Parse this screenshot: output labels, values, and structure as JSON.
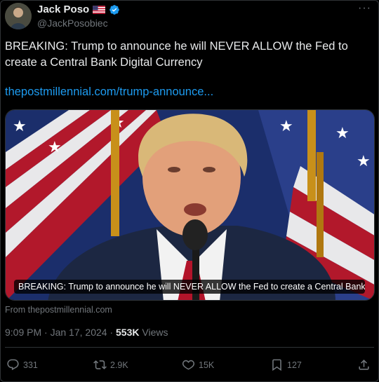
{
  "author": {
    "display_name": "Jack Poso",
    "handle": "@JackPosobiec",
    "flag_icon": "us-flag-icon",
    "verified_icon": "verified-badge-icon",
    "verified_color": "#1d9bf0"
  },
  "menu": {
    "more_label": "···"
  },
  "tweet": {
    "text": "BREAKING: Trump to announce he will NEVER ALLOW the Fed to create a Central Bank Digital Currency",
    "link": "thepostmillennial.com/trump-announce...",
    "link_color": "#1d9bf0"
  },
  "media": {
    "caption": "BREAKING: Trump to announce he will NEVER ALLOW the Fed to create a Central Bank ...",
    "source": "From thepostmillennial.com"
  },
  "meta": {
    "time": "9:09 PM",
    "separator": " · ",
    "date": "Jan 17, 2024",
    "separator2": " · ",
    "views_count": "553K",
    "views_label": " Views"
  },
  "actions": {
    "replies": "331",
    "reposts": "2.9K",
    "likes": "15K",
    "bookmarks": "127"
  },
  "colors": {
    "background": "#000000",
    "text_primary": "#e7e9ea",
    "text_secondary": "#71767b",
    "border": "#2f3336"
  }
}
